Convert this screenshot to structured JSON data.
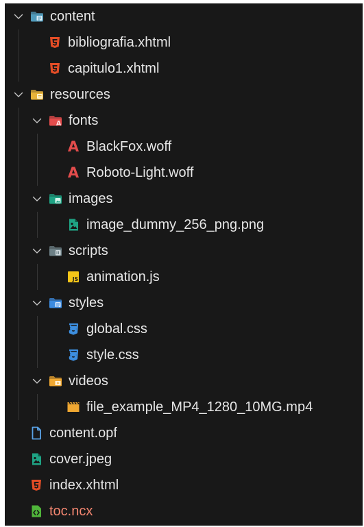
{
  "tree": [
    {
      "label": "content",
      "depth": 0,
      "kind": "folder",
      "icon": "folder-content-icon",
      "color": "#519aba",
      "expanded": true
    },
    {
      "label": "bibliografia.xhtml",
      "depth": 1,
      "kind": "file",
      "icon": "html5-icon",
      "color": "#e44d26"
    },
    {
      "label": "capitulo1.xhtml",
      "depth": 1,
      "kind": "file",
      "icon": "html5-icon",
      "color": "#e44d26"
    },
    {
      "label": "resources",
      "depth": 0,
      "kind": "folder",
      "icon": "folder-resources-icon",
      "color": "#e8b33a",
      "expanded": true
    },
    {
      "label": "fonts",
      "depth": 1,
      "kind": "folder",
      "icon": "folder-fonts-icon",
      "color": "#e34c4c",
      "expanded": true
    },
    {
      "label": "BlackFox.woff",
      "depth": 2,
      "kind": "file",
      "icon": "font-icon",
      "color": "#e34c4c"
    },
    {
      "label": "Roboto-Light.woff",
      "depth": 2,
      "kind": "file",
      "icon": "font-icon",
      "color": "#e34c4c"
    },
    {
      "label": "images",
      "depth": 1,
      "kind": "folder",
      "icon": "folder-images-icon",
      "color": "#1fa384",
      "expanded": true
    },
    {
      "label": "image_dummy_256_png.png",
      "depth": 2,
      "kind": "file",
      "icon": "image-file-icon",
      "color": "#1fa384"
    },
    {
      "label": "scripts",
      "depth": 1,
      "kind": "folder",
      "icon": "folder-scripts-icon",
      "color": "#6d8086",
      "expanded": true
    },
    {
      "label": "animation.js",
      "depth": 2,
      "kind": "file",
      "icon": "javascript-icon",
      "color": "#f5c518"
    },
    {
      "label": "styles",
      "depth": 1,
      "kind": "folder",
      "icon": "folder-styles-icon",
      "color": "#3c8be0",
      "expanded": true
    },
    {
      "label": "global.css",
      "depth": 2,
      "kind": "file",
      "icon": "css3-icon",
      "color": "#3d8fe0"
    },
    {
      "label": "style.css",
      "depth": 2,
      "kind": "file",
      "icon": "css3-icon",
      "color": "#3d8fe0"
    },
    {
      "label": "videos",
      "depth": 1,
      "kind": "folder",
      "icon": "folder-videos-icon",
      "color": "#f0a832",
      "expanded": true
    },
    {
      "label": "file_example_MP4_1280_10MG.mp4",
      "depth": 2,
      "kind": "file",
      "icon": "video-file-icon",
      "color": "#f0a832"
    },
    {
      "label": "content.opf",
      "depth": 0,
      "kind": "file",
      "icon": "document-icon",
      "color": "#5aa2e6"
    },
    {
      "label": "cover.jpeg",
      "depth": 0,
      "kind": "file",
      "icon": "image-file-icon",
      "color": "#1fa384"
    },
    {
      "label": "index.xhtml",
      "depth": 0,
      "kind": "file",
      "icon": "html5-icon",
      "color": "#e44d26"
    },
    {
      "label": "toc.ncx",
      "depth": 0,
      "kind": "file",
      "icon": "ncx-file-icon",
      "color": "#4fb53a",
      "warn": true,
      "warn_color": "#f48771"
    }
  ]
}
